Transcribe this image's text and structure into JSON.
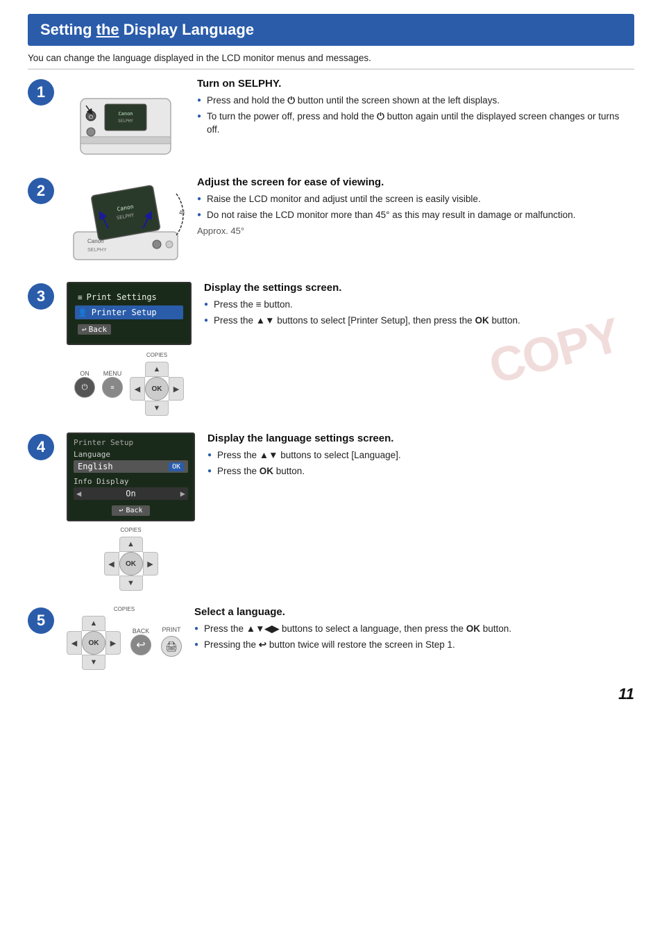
{
  "page": {
    "title_plain": "Setting the Display Language",
    "title_underline": "the",
    "intro": "You can change the language displayed in the LCD monitor menus and messages.",
    "page_number": "11"
  },
  "steps": [
    {
      "number": "1",
      "title": "Turn on SELPHY.",
      "bullets": [
        "Press and hold the ⏻ button until the screen shown at the left displays.",
        "To turn the power off, press and hold the ⏻ button again until the displayed screen changes or turns off."
      ]
    },
    {
      "number": "2",
      "title": "Adjust the screen for ease of viewing.",
      "bullets": [
        "Raise the LCD monitor and adjust until the screen is easily visible.",
        "Do not raise the LCD monitor more than 45° as this may result in damage or malfunction."
      ],
      "approx": "Approx. 45°"
    },
    {
      "number": "3",
      "title": "Display the settings screen.",
      "bullets": [
        "Press the ≡ button.",
        "Press the ▲▼ buttons to select [Printer Setup], then press the OK button."
      ],
      "lcd": {
        "row1_icon": "≡",
        "row1_text": "Print Settings",
        "row2_icon": "👤",
        "row2_text": "Printer Setup",
        "row3_text": "Back"
      }
    },
    {
      "number": "4",
      "title": "Display the language settings screen.",
      "bullets": [
        "Press the ▲▼ buttons to select [Language].",
        "Press the OK button."
      ],
      "lcd4": {
        "title": "Printer Setup",
        "lang_label": "Language",
        "lang_value": "English",
        "info_label": "Info Display",
        "info_value": "On",
        "back": "Back"
      }
    },
    {
      "number": "5",
      "title": "Select a language.",
      "bullets": [
        "Press the ▲▼◀▶ buttons to select a language, then press the OK button.",
        "Pressing the ↩ button twice will restore the screen in Step 1."
      ]
    }
  ],
  "controls": {
    "copies_label": "COPIES",
    "on_label": "ON",
    "menu_label": "MENU",
    "ok_label": "OK",
    "back_label": "BACK",
    "print_label": "PRINT"
  },
  "copy_stamp": "COPY"
}
